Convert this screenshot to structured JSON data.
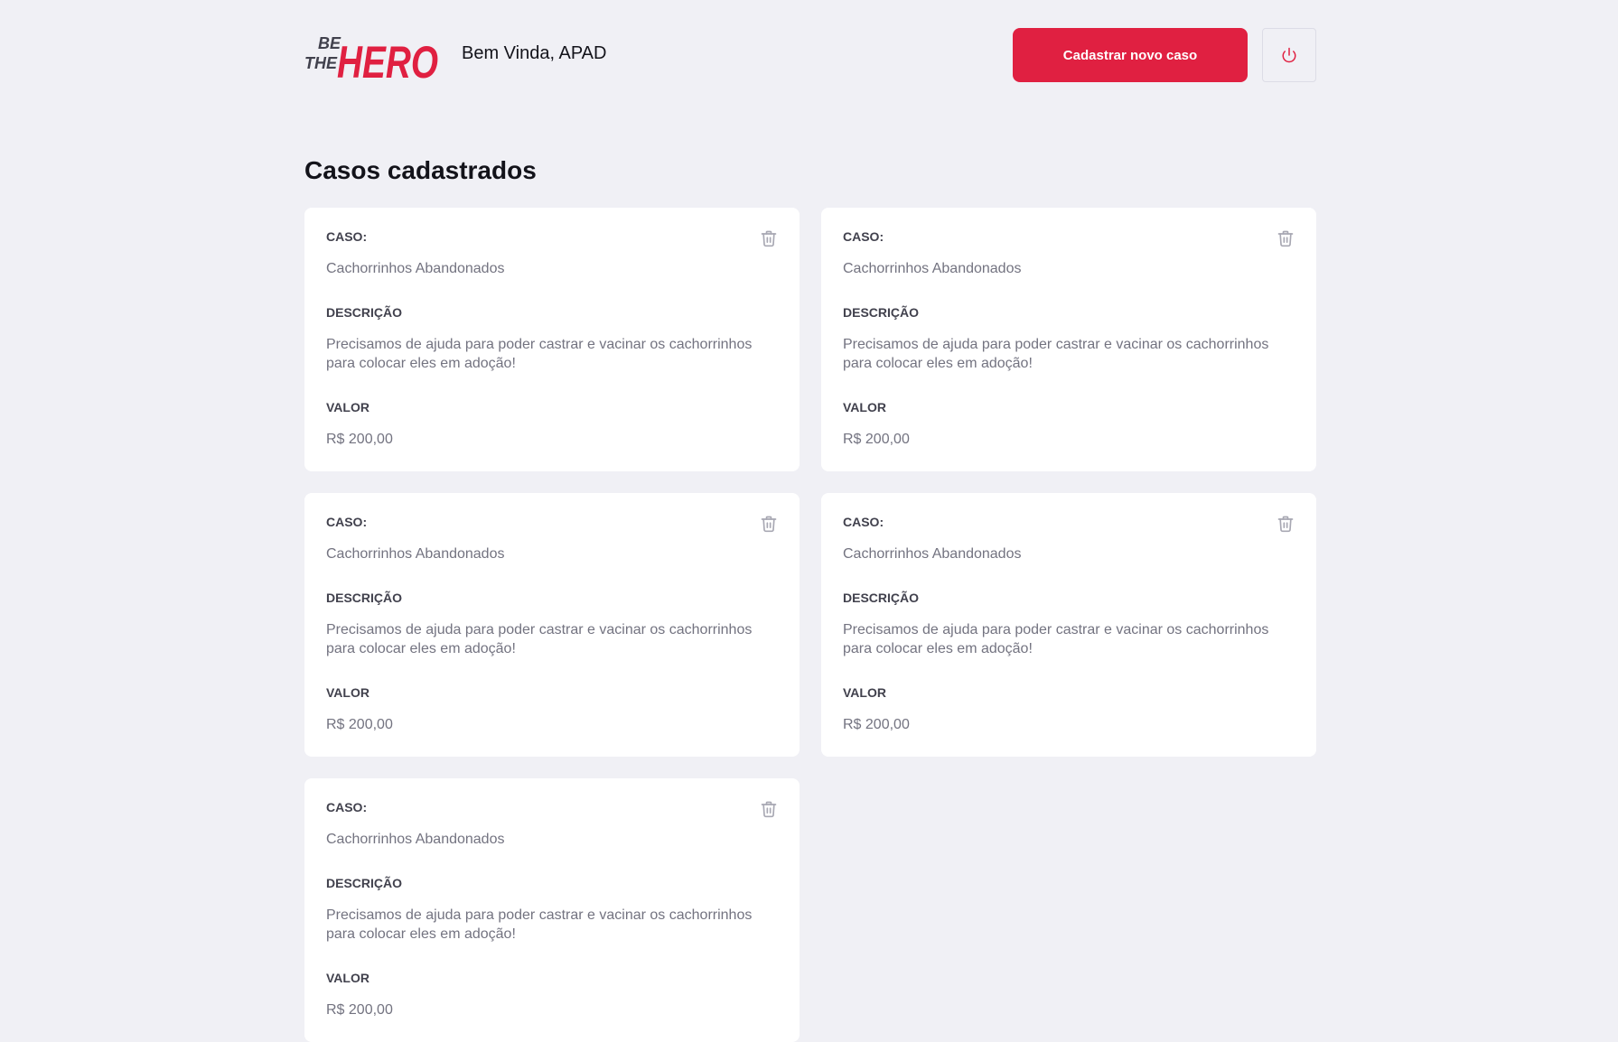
{
  "brand": {
    "logo_line1": "BE",
    "logo_line2": "THE",
    "logo_word": "HERO",
    "accent_color": "#e02041"
  },
  "header": {
    "greeting": "Bem Vinda, APAD",
    "new_case_button": "Cadastrar novo caso",
    "logout_icon": "power-icon"
  },
  "page": {
    "title": "Casos cadastrados"
  },
  "labels": {
    "case": "CASO:",
    "description": "DESCRIÇÃO",
    "value": "VALOR"
  },
  "cases": [
    {
      "title": "Cachorrinhos Abandonados",
      "description": "Precisamos de ajuda para poder castrar e vacinar os cachorrinhos para colocar eles em adoção!",
      "value": "R$ 200,00"
    },
    {
      "title": "Cachorrinhos Abandonados",
      "description": "Precisamos de ajuda para poder castrar e vacinar os cachorrinhos para colocar eles em adoção!",
      "value": "R$ 200,00"
    },
    {
      "title": "Cachorrinhos Abandonados",
      "description": "Precisamos de ajuda para poder castrar e vacinar os cachorrinhos para colocar eles em adoção!",
      "value": "R$ 200,00"
    },
    {
      "title": "Cachorrinhos Abandonados",
      "description": "Precisamos de ajuda para poder castrar e vacinar os cachorrinhos para colocar eles em adoção!",
      "value": "R$ 200,00"
    },
    {
      "title": "Cachorrinhos Abandonados",
      "description": "Precisamos de ajuda para poder castrar e vacinar os cachorrinhos para colocar eles em adoção!",
      "value": "R$ 200,00"
    }
  ],
  "card_icon": "trash-icon"
}
